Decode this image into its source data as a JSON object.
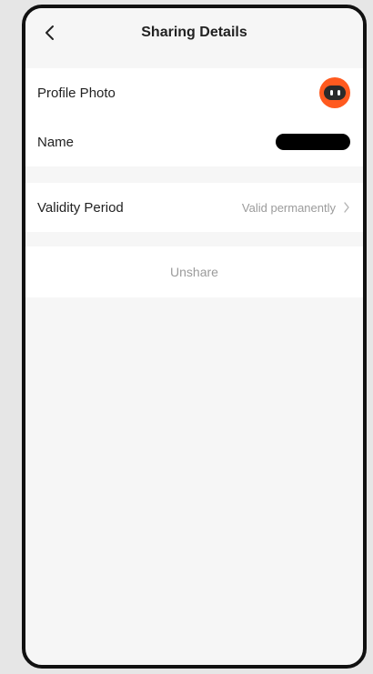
{
  "header": {
    "title": "Sharing Details",
    "back_icon": "chevron-left-icon"
  },
  "profile": {
    "photo_label": "Profile Photo",
    "avatar_icon": "robot-avatar-icon",
    "avatar_color": "#ff5a1f",
    "name_label": "Name"
  },
  "validity": {
    "label": "Validity Period",
    "value": "Valid permanently",
    "chevron_icon": "chevron-right-icon"
  },
  "actions": {
    "unshare_label": "Unshare"
  }
}
